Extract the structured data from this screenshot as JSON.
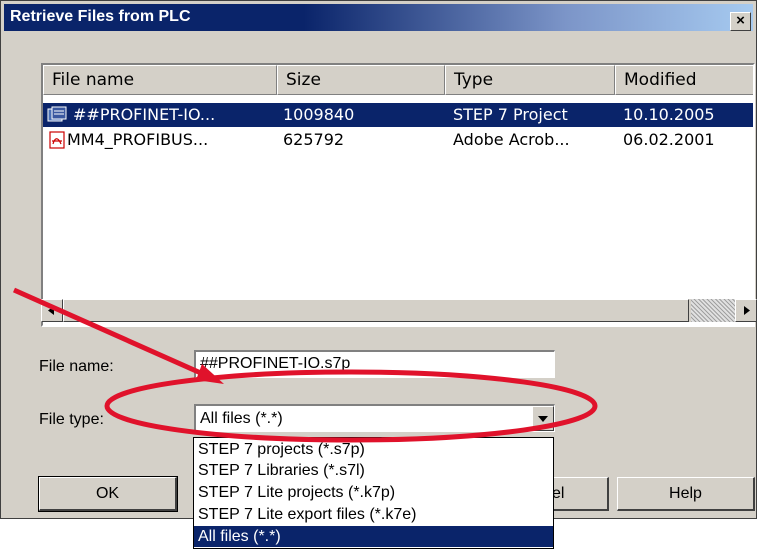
{
  "window": {
    "title": "Retrieve Files from PLC",
    "close_glyph": "×"
  },
  "list": {
    "columns": [
      "File name",
      "Size",
      "Type",
      "Modified"
    ],
    "rows": [
      {
        "icon": "step7-project-icon",
        "name": "##PROFINET-IO...",
        "size": "1009840",
        "type": "STEP 7 Project",
        "modified": "10.10.2005",
        "selected": true
      },
      {
        "icon": "pdf-icon",
        "name": "MM4_PROFIBUS...",
        "size": "625792",
        "type": "Adobe Acrob...",
        "modified": "06.02.2001",
        "selected": false
      }
    ]
  },
  "form": {
    "file_name_label": "File name:",
    "file_name_value": "##PROFINET-IO.s7p",
    "file_type_label": "File type:",
    "file_type_value": "All files (*.*)",
    "file_type_options": [
      "STEP 7 projects (*.s7p)",
      "STEP 7 Libraries (*.s7l)",
      "STEP 7 Lite projects (*.k7p)",
      "STEP 7 Lite export files (*.k7e)",
      "All files (*.*)"
    ],
    "selected_option": "All files (*.*)"
  },
  "buttons": {
    "ok": "OK",
    "cancel": "Cancel",
    "help": "Help"
  },
  "annotation": {
    "color": "#e0122b"
  },
  "colors": {
    "selection": "#0a246a",
    "dialog_bg": "#d4d0c8"
  }
}
